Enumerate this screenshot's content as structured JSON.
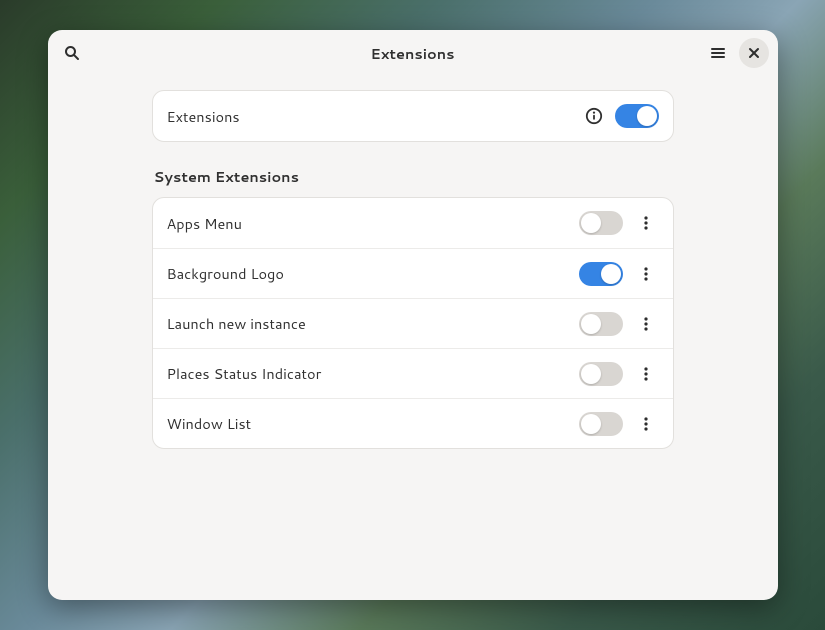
{
  "header": {
    "title": "Extensions"
  },
  "master": {
    "label": "Extensions",
    "enabled": true
  },
  "section": {
    "title": "System Extensions"
  },
  "extensions": [
    {
      "name": "Apps Menu",
      "enabled": false
    },
    {
      "name": "Background Logo",
      "enabled": true
    },
    {
      "name": "Launch new instance",
      "enabled": false
    },
    {
      "name": "Places Status Indicator",
      "enabled": false
    },
    {
      "name": "Window List",
      "enabled": false
    }
  ],
  "colors": {
    "accent": "#3584e4",
    "window_bg": "#f6f5f4",
    "card_bg": "#ffffff"
  }
}
